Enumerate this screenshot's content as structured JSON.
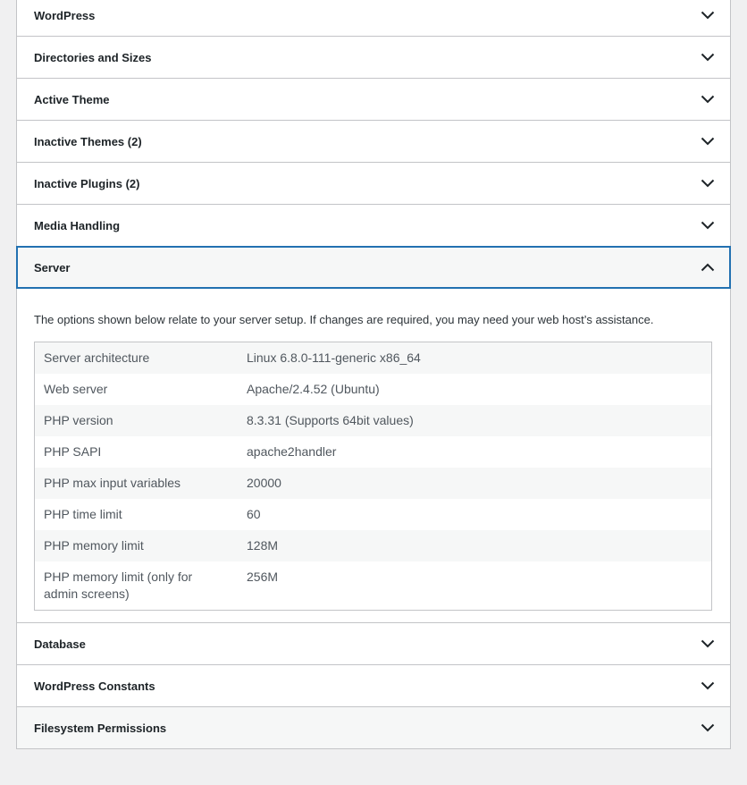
{
  "sections_top": [
    {
      "label": "WordPress"
    },
    {
      "label": "Directories and Sizes"
    },
    {
      "label": "Active Theme"
    },
    {
      "label": "Inactive Themes (2)"
    },
    {
      "label": "Inactive Plugins (2)"
    },
    {
      "label": "Media Handling"
    }
  ],
  "server": {
    "label": "Server",
    "description": "The options shown below relate to your server setup. If changes are required, you may need your web host’s assistance.",
    "rows": [
      {
        "label": "Server architecture",
        "value": "Linux 6.8.0-111-generic x86_64"
      },
      {
        "label": "Web server",
        "value": "Apache/2.4.52 (Ubuntu)"
      },
      {
        "label": "PHP version",
        "value": "8.3.31 (Supports 64bit values)"
      },
      {
        "label": "PHP SAPI",
        "value": "apache2handler"
      },
      {
        "label": "PHP max input variables",
        "value": "20000"
      },
      {
        "label": "PHP time limit",
        "value": "60"
      },
      {
        "label": "PHP memory limit",
        "value": "128M"
      },
      {
        "label": "PHP memory limit (only for admin screens)",
        "value": "256M"
      }
    ]
  },
  "sections_bottom": [
    {
      "label": "Database"
    },
    {
      "label": "WordPress Constants"
    },
    {
      "label": "Filesystem Permissions"
    }
  ],
  "colors": {
    "page_bg": "#f0f0f1",
    "border": "#c3c4c7",
    "focus": "#2271b1",
    "text": "#1d2327",
    "muted_text": "#50575e"
  },
  "icons": {
    "collapsed": "chevron-down-icon",
    "expanded": "chevron-up-icon"
  }
}
